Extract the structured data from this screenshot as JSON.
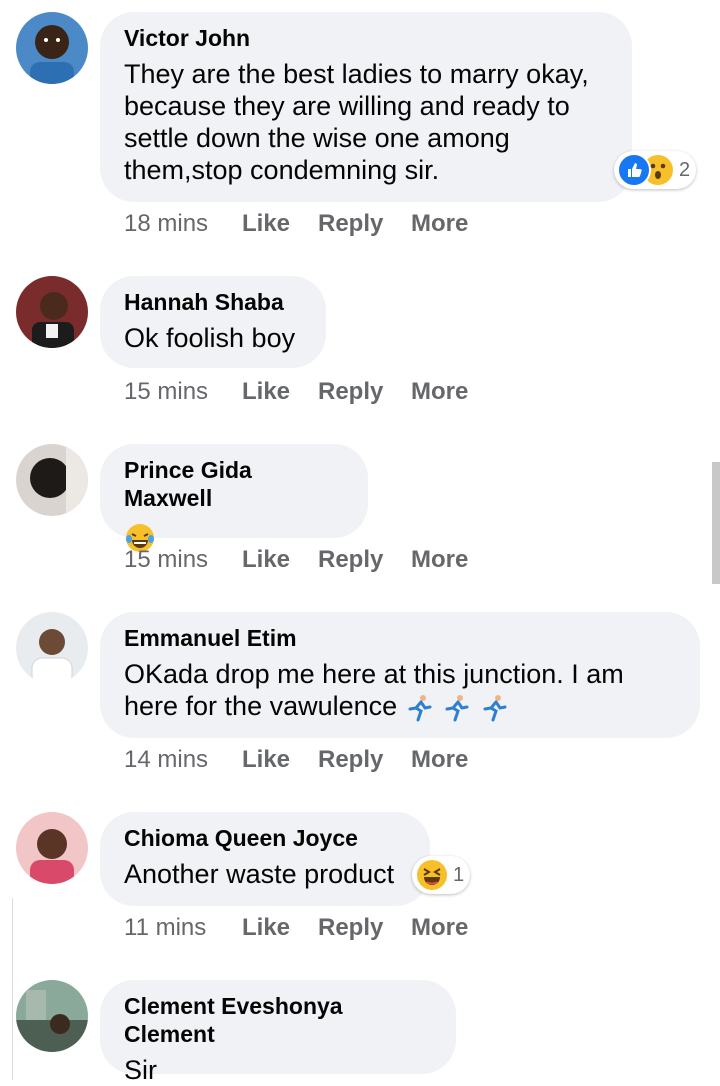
{
  "comments": [
    {
      "name": "Victor John",
      "text_lines": [
        "They are the best ladies to marry okay,",
        "because they are willing and ready to",
        "settle down the wise one among",
        "them,stop condemning sir."
      ],
      "time": "18 mins",
      "reaction_count": "2",
      "reactions": [
        "like-icon",
        "wow-icon"
      ]
    },
    {
      "name": "Hannah Shaba",
      "text": "Ok foolish boy",
      "time": "15 mins"
    },
    {
      "name": "Prince Gida Maxwell",
      "emoji": "laughing-tears-emoji",
      "time": "15 mins"
    },
    {
      "name": "Emmanuel Etim",
      "text_lines": [
        "OKada drop me here at this junction. I am",
        "here for the vawulence"
      ],
      "trailing_emoji": "running-man-emoji x3",
      "time": "14 mins"
    },
    {
      "name": "Chioma Queen Joyce",
      "text": "Another waste product",
      "time": "11 mins",
      "reaction_count": "1",
      "reactions": [
        "haha-icon"
      ]
    },
    {
      "name": "Clement Eveshonya Clement",
      "text": "Sir"
    }
  ],
  "actions": {
    "like": "Like",
    "reply": "Reply",
    "more": "More"
  },
  "colors": {
    "bubble": "#f0f2f5",
    "meta": "#65676b",
    "like_blue": "#1877f2",
    "emoji_yellow": "#f7c02b"
  }
}
